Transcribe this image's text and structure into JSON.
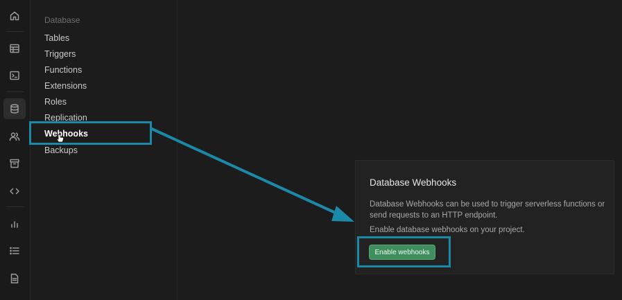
{
  "rail": {
    "icons": [
      "home-icon",
      "table-icon",
      "terminal-icon",
      "database-icon",
      "users-icon",
      "archive-icon",
      "code-icon",
      "chart-icon",
      "list-icon",
      "document-icon"
    ],
    "active": "database-icon"
  },
  "menu": {
    "heading": "Database",
    "items": [
      {
        "label": "Tables"
      },
      {
        "label": "Triggers"
      },
      {
        "label": "Functions"
      },
      {
        "label": "Extensions"
      },
      {
        "label": "Roles"
      },
      {
        "label": "Replication"
      },
      {
        "label": "Webhooks",
        "active": true
      },
      {
        "label": "Backups"
      }
    ]
  },
  "card": {
    "title": "Database Webhooks",
    "description": "Database Webhooks can be used to trigger serverless functions or send requests to an HTTP endpoint.",
    "hint": "Enable database webhooks on your project.",
    "button_label": "Enable webhooks"
  },
  "colors": {
    "annotation": "#1a8aa8",
    "button": "#3f8f5e",
    "background": "#1c1c1c"
  }
}
